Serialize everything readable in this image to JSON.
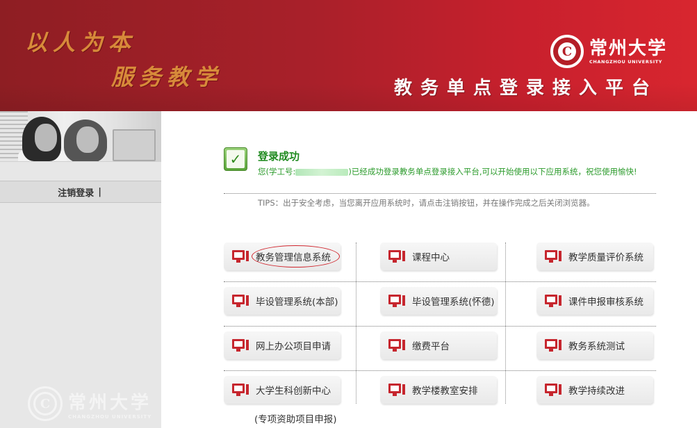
{
  "header": {
    "slogan_line1": "以人为本",
    "slogan_line2": "服务教学",
    "university_cn": "常州大学",
    "university_en": "CHANGZHOU UNIVERSITY",
    "platform_title": "教务单点登录接入平台"
  },
  "sidebar": {
    "logout_label": "注销登录",
    "separator": "|",
    "watermark_cn": "常州大学",
    "watermark_en": "CHANGZHOU UNIVERSITY"
  },
  "message": {
    "title": "登录成功",
    "prefix": "您(学工号:",
    "body": ")已经成功登录教务单点登录接入平台,可以开始使用以下应用系统，祝您使用愉快!",
    "tips": "TIPS：出于安全考虑，当您离开应用系统时，请点击注销按钮，并在操作完成之后关闭浏览器。"
  },
  "apps": [
    {
      "label": "教务管理信息系统"
    },
    {
      "label": "课程中心"
    },
    {
      "label": "教学质量评价系统"
    },
    {
      "label": "毕设管理系统(本部)"
    },
    {
      "label": "毕设管理系统(怀德)"
    },
    {
      "label": "课件申报审核系统"
    },
    {
      "label": "网上办公项目申请"
    },
    {
      "label": "缴费平台"
    },
    {
      "label": "教务系统测试"
    },
    {
      "label": "大学生科创新中心"
    },
    {
      "label": "教学楼教室安排"
    },
    {
      "label": "教学持续改进"
    }
  ],
  "apps_sub_label": "(专项资助项目申报)",
  "colors": {
    "brand_red": "#c8202d",
    "success_green": "#1f8a1f",
    "icon_red": "#c6262e"
  },
  "icons": {
    "app": "computer-icon",
    "success": "checkmark-icon"
  }
}
